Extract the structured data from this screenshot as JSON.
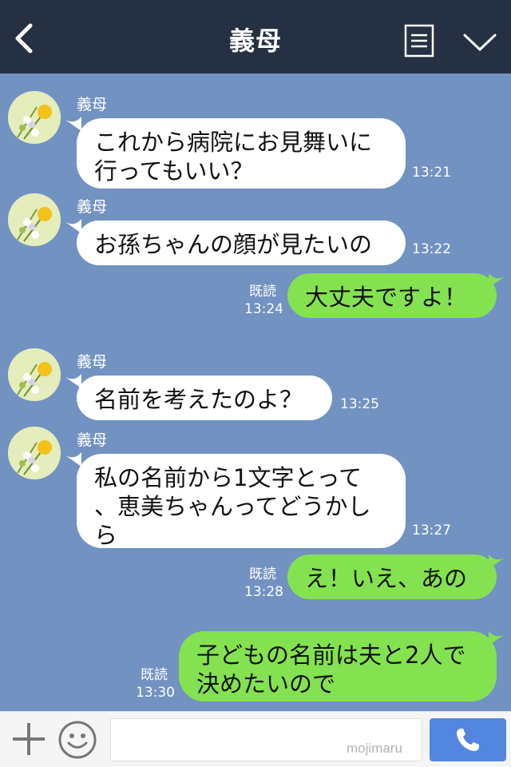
{
  "header": {
    "title": "義母",
    "back_icon": "chevron-left-icon",
    "menu_icon": "list-icon",
    "dropdown_icon": "chevron-down-icon"
  },
  "messages": [
    {
      "direction": "in",
      "sender": "義母",
      "lines": [
        "これから病院にお見舞いに",
        "行ってもいい？"
      ],
      "time": "13:21"
    },
    {
      "direction": "in",
      "sender": "義母",
      "lines": [
        "お孫ちゃんの顔が見たいの"
      ],
      "time": "13:22"
    },
    {
      "direction": "out",
      "lines": [
        "大丈夫ですよ！"
      ],
      "read": "既読",
      "time": "13:24"
    },
    {
      "direction": "in",
      "sender": "義母",
      "lines": [
        "名前を考えたのよ？"
      ],
      "time": "13:25"
    },
    {
      "direction": "in",
      "sender": "義母",
      "lines": [
        "私の名前から1文字とって",
        "、恵美ちゃんってどうかし",
        "ら"
      ],
      "time": "13:27"
    },
    {
      "direction": "out",
      "lines": [
        "え！いえ、あの"
      ],
      "read": "既読",
      "time": "13:28"
    },
    {
      "direction": "out",
      "lines": [
        "子どもの名前は夫と2人で",
        "決めたいので"
      ],
      "read": "既読",
      "time": "13:30"
    }
  ],
  "input_bar": {
    "placeholder": "",
    "watermark": "mojimaru",
    "plus_icon": "plus-icon",
    "emoji_icon": "smiley-icon",
    "call_icon": "phone-icon"
  },
  "colors": {
    "header_bg": "#263043",
    "chat_bg": "#7292c2",
    "incoming_bubble": "#ffffff",
    "outgoing_bubble": "#84e250",
    "call_button": "#5286e0"
  }
}
